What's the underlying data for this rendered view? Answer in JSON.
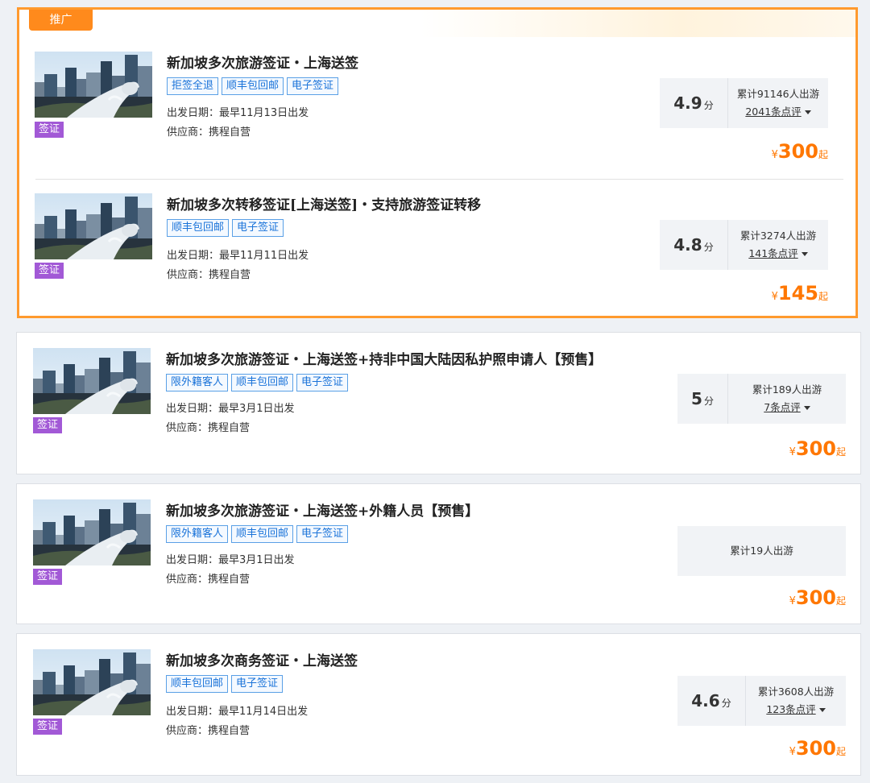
{
  "promo_label": "推广",
  "items": [
    {
      "title": "新加坡多次旅游签证・上海送签",
      "badges": [
        "拒签全退",
        "顺丰包回邮",
        "电子签证"
      ],
      "departure": "出发日期：最早11月13日出发",
      "supplier": "供应商：携程自营",
      "visa_tag": "签证",
      "score": "4.9",
      "score_unit": "分",
      "travelers": "累计91146人出游",
      "reviews": "2041条点评",
      "currency": "¥",
      "price": "300",
      "price_suffix": "起"
    },
    {
      "title": "新加坡多次转移签证[上海送签]・支持旅游签证转移",
      "badges": [
        "顺丰包回邮",
        "电子签证"
      ],
      "departure": "出发日期：最早11月11日出发",
      "supplier": "供应商：携程自营",
      "visa_tag": "签证",
      "score": "4.8",
      "score_unit": "分",
      "travelers": "累计3274人出游",
      "reviews": "141条点评",
      "currency": "¥",
      "price": "145",
      "price_suffix": "起"
    },
    {
      "title": "新加坡多次旅游签证・上海送签+持非中国大陆因私护照申请人【预售】",
      "badges": [
        "限外籍客人",
        "顺丰包回邮",
        "电子签证"
      ],
      "departure": "出发日期：最早3月1日出发",
      "supplier": "供应商：携程自营",
      "visa_tag": "签证",
      "score": "5",
      "score_unit": "分",
      "travelers": "累计189人出游",
      "reviews": "7条点评",
      "currency": "¥",
      "price": "300",
      "price_suffix": "起"
    },
    {
      "title": "新加坡多次旅游签证・上海送签+外籍人员【预售】",
      "badges": [
        "限外籍客人",
        "顺丰包回邮",
        "电子签证"
      ],
      "departure": "出发日期：最早3月1日出发",
      "supplier": "供应商：携程自营",
      "visa_tag": "签证",
      "travelers": "累计19人出游",
      "currency": "¥",
      "price": "300",
      "price_suffix": "起"
    },
    {
      "title": "新加坡多次商务签证・上海送签",
      "badges": [
        "顺丰包回邮",
        "电子签证"
      ],
      "departure": "出发日期：最早11月14日出发",
      "supplier": "供应商：携程自营",
      "visa_tag": "签证",
      "score": "4.6",
      "score_unit": "分",
      "travelers": "累计3608人出游",
      "reviews": "123条点评",
      "currency": "¥",
      "price": "300",
      "price_suffix": "起"
    }
  ],
  "colors": {
    "promo_border": "#ff9a2e",
    "price": "#ff7700",
    "visa_tag": "#a259d6",
    "badge": "#1a73d9"
  }
}
